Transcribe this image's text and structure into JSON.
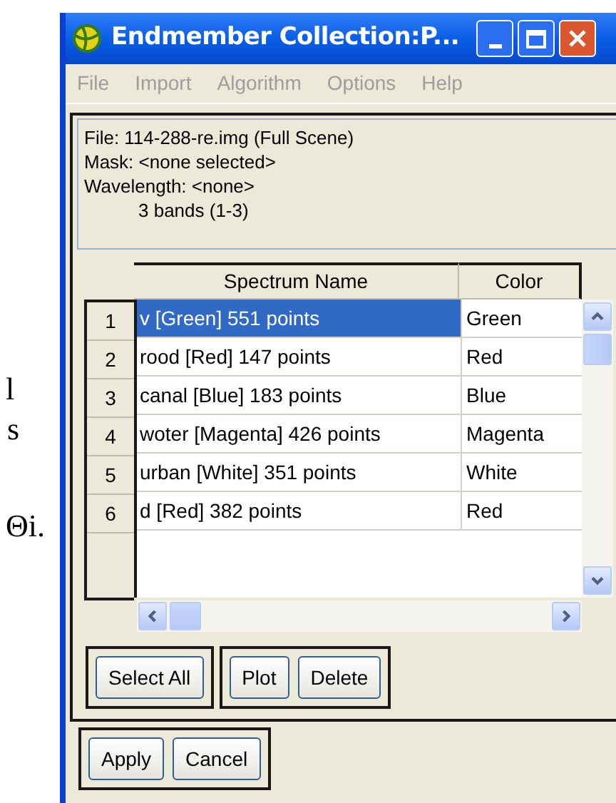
{
  "background_text": [
    "l",
    "s",
    "Θi."
  ],
  "window": {
    "title": "Endmember Collection:P..."
  },
  "menu": [
    {
      "label": "File",
      "disabled": true
    },
    {
      "label": "Import",
      "disabled": true
    },
    {
      "label": "Algorithm",
      "disabled": true
    },
    {
      "label": "Options",
      "disabled": true
    },
    {
      "label": "Help",
      "disabled": true
    }
  ],
  "info": [
    {
      "text": "File: 114-288-re.img (Full Scene)",
      "indented": false
    },
    {
      "text": "Mask: <none selected>",
      "indented": false
    },
    {
      "text": "Wavelength: <none>",
      "indented": false
    },
    {
      "text": "3 bands (1-3)",
      "indented": true
    }
  ],
  "table": {
    "columns": [
      "Spectrum Name",
      "Color"
    ],
    "rows": [
      {
        "number": "1",
        "name": "v [Green] 551 points",
        "color_name": "Green",
        "selected": true
      },
      {
        "number": "2",
        "name": "rood [Red] 147 points",
        "color_name": "Red",
        "selected": false
      },
      {
        "number": "3",
        "name": "canal [Blue] 183 points",
        "color_name": "Blue",
        "selected": false
      },
      {
        "number": "4",
        "name": "woter [Magenta] 426 points",
        "color_name": "Magenta",
        "selected": false
      },
      {
        "number": "5",
        "name": "urban [White] 351 points",
        "color_name": "White",
        "selected": false
      },
      {
        "number": "6",
        "name": "d [Red] 382 points",
        "color_name": "Red",
        "selected": false
      }
    ]
  },
  "button_groups": [
    [
      "Select All"
    ],
    [
      "Plot",
      "Delete"
    ]
  ],
  "dialog_buttons": [
    "Apply",
    "Cancel"
  ]
}
